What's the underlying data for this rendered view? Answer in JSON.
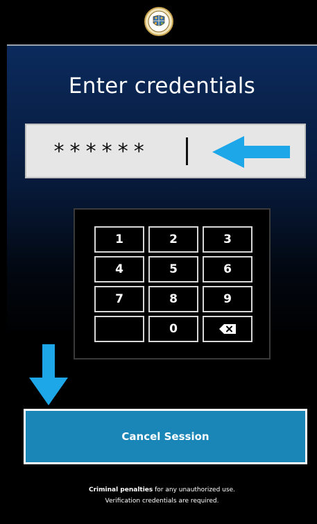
{
  "header": {
    "seal_icon": "county-seal-icon"
  },
  "title": "Enter credentials",
  "pin_field": {
    "value": "******",
    "hint_arrow_icon": "arrow-left-icon"
  },
  "keypad": {
    "keys": [
      "1",
      "2",
      "3",
      "4",
      "5",
      "6",
      "7",
      "8",
      "9",
      "",
      "0"
    ],
    "backspace_icon": "backspace-icon"
  },
  "down_arrow_icon": "arrow-down-icon",
  "cancel_button": {
    "label": "Cancel Session"
  },
  "footer": {
    "bold_text": "Criminal penalties",
    "line1_rest": " for any unauthorized use.",
    "line2": "Verification credentials are required."
  },
  "colors": {
    "accent_blue": "#1a86b8",
    "arrow_blue": "#1ea7e8",
    "header_gradient_top": "#0b2a5c"
  }
}
